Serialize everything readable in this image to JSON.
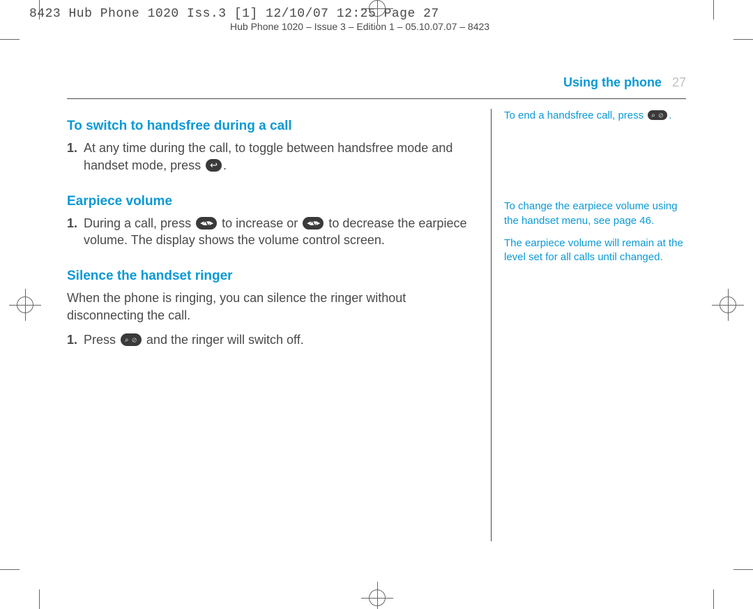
{
  "slug": "8423 Hub Phone 1020 Iss.3 [1]  12/10/07  12:25  Page 27",
  "slug_secondary": "Hub Phone 1020 – Issue 3 – Edition 1 – 05.10.07.07 – 8423",
  "running_head": {
    "title": "Using the phone",
    "page": "27"
  },
  "main": {
    "s1": {
      "heading": "To switch to handsfree during a call",
      "item1_a": "At any time during the call, to toggle between handsfree mode and handset mode, press ",
      "item1_b": "."
    },
    "s2": {
      "heading": "Earpiece volume",
      "item1_a": "During a call, press ",
      "item1_b": " to increase or ",
      "item1_c": " to decrease the earpiece volume. The display shows the volume control screen."
    },
    "s3": {
      "heading": "Silence the handset ringer",
      "intro": "When the phone is ringing, you can silence the ringer without disconnecting the call.",
      "item1_a": "Press ",
      "item1_b": " and the ringer will switch off."
    },
    "num1": "1."
  },
  "side": {
    "n1_a": "To end a handsfree call, press ",
    "n1_b": ".",
    "n2": "To change the earpiece volume using the handset menu, see page 46.",
    "n3": "The earpiece volume will remain at the level set for all calls until changed."
  }
}
